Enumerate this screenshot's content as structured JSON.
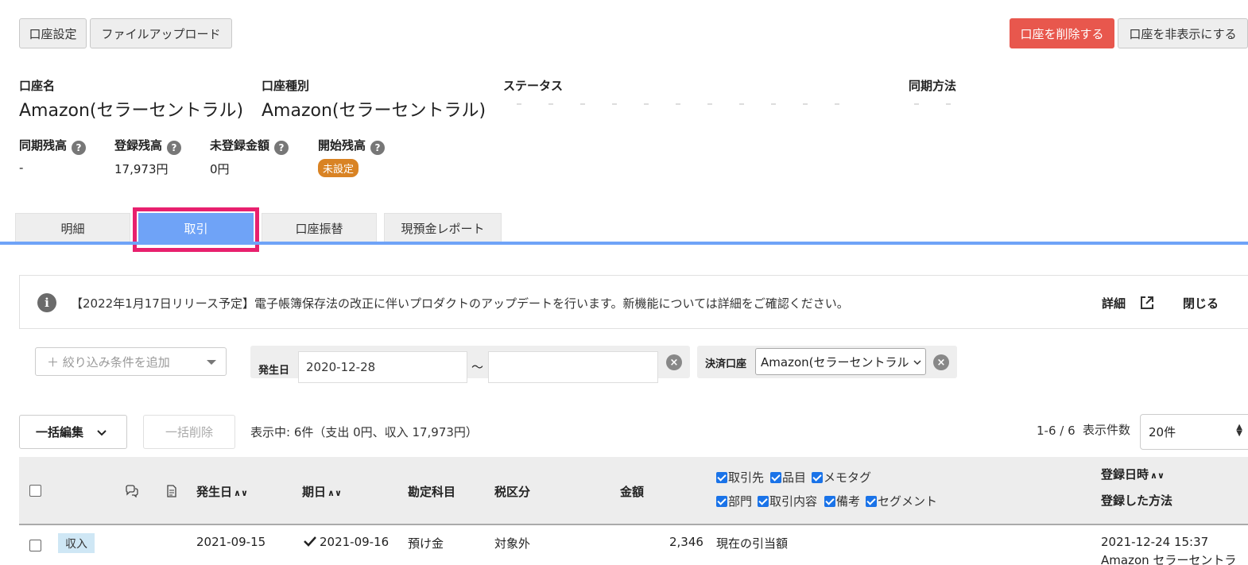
{
  "top_buttons": {
    "account_settings": "口座設定",
    "file_upload": "ファイルアップロード",
    "delete_account": "口座を削除する",
    "hide_account": "口座を非表示にする"
  },
  "account": {
    "name_label": "口座名",
    "name_value": "Amazon(セラーセントラル)",
    "type_label": "口座種別",
    "type_value": "Amazon(セラーセントラル)",
    "status_label": "ステータス",
    "sync_method_label": "同期方法"
  },
  "balances": {
    "synced_label": "同期残高",
    "synced_value": "-",
    "registered_label": "登録残高",
    "registered_value": "17,973円",
    "unregistered_label": "未登録金額",
    "unregistered_value": "0円",
    "opening_label": "開始残高",
    "opening_badge": "未設定",
    "help": "?"
  },
  "tabs": [
    "明細",
    "取引",
    "口座振替",
    "現預金レポート"
  ],
  "notice": {
    "info": "i",
    "text": "【2022年1月17日リリース予定】電子帳簿保存法の改正に伴いプロダクトのアップデートを行います。新機能については詳細をご確認ください。",
    "details": "詳細",
    "close": "閉じる"
  },
  "filters": {
    "add_placeholder": "＋ 絞り込み条件を追加",
    "date_label": "発生日",
    "date_from": "2020-12-28",
    "date_to": "",
    "range_sep": "〜",
    "clear": "×",
    "account_label": "決済口座",
    "account_value": "Amazon(セラーセントラル"
  },
  "toolbar": {
    "bulk_edit": "一括編集",
    "bulk_delete": "一括削除",
    "summary": "表示中: 6件（支出 0円、収入 17,973円）",
    "pager": "1-6 / 6",
    "per_page_label": "表示件数",
    "per_page_value": "20件"
  },
  "table": {
    "headers": {
      "date": "発生日",
      "due": "期日",
      "account_item": "勘定科目",
      "tax": "税区分",
      "amount": "金額",
      "registered_at": "登録日時",
      "registered_method": "登録した方法",
      "sort": "∧∨"
    },
    "column_toggles_row1": [
      "取引先",
      "品目",
      "メモタグ"
    ],
    "column_toggles_row2": [
      "部門",
      "取引内容",
      "備考",
      "セグメント"
    ],
    "rows": [
      {
        "type": "収入",
        "date": "2021-09-15",
        "due": "2021-09-16",
        "account_item": "預け金",
        "tax": "対象外",
        "amount": "2,346",
        "description": "現在の引当額",
        "registered_at": "2021-12-24 15:37",
        "registered_method": "Amazon セラーセントラ"
      }
    ]
  }
}
